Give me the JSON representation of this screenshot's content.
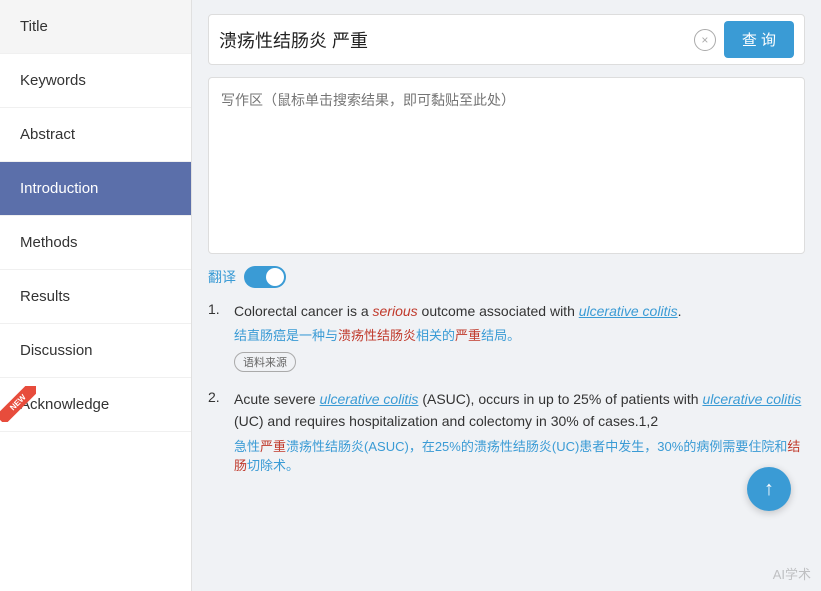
{
  "sidebar": {
    "items": [
      {
        "id": "title",
        "label": "Title",
        "active": false,
        "new": false
      },
      {
        "id": "keywords",
        "label": "Keywords",
        "active": false,
        "new": false
      },
      {
        "id": "abstract",
        "label": "Abstract",
        "active": false,
        "new": false
      },
      {
        "id": "introduction",
        "label": "Introduction",
        "active": true,
        "new": false
      },
      {
        "id": "methods",
        "label": "Methods",
        "active": false,
        "new": false
      },
      {
        "id": "results",
        "label": "Results",
        "active": false,
        "new": false
      },
      {
        "id": "discussion",
        "label": "Discussion",
        "active": false,
        "new": false
      },
      {
        "id": "acknowledge",
        "label": "Acknowledge",
        "active": false,
        "new": true
      }
    ]
  },
  "search": {
    "query": "溃疡性结肠炎 严重",
    "clear_title": "×",
    "submit_label": "查 询",
    "placeholder": "写作区（鼠标单击搜索结果，即可黏贴至此处）"
  },
  "translate": {
    "label": "翻译",
    "enabled": true
  },
  "results": [
    {
      "number": "1.",
      "en_parts": [
        {
          "text": "Colorectal cancer is a ",
          "style": "normal"
        },
        {
          "text": "serious",
          "style": "italic-red"
        },
        {
          "text": " outcome associated with ",
          "style": "normal"
        },
        {
          "text": "ulcerative colitis",
          "style": "italic-blue-link"
        },
        {
          "text": ".",
          "style": "normal"
        }
      ],
      "zh": "结直肠癌是一种与溃疡性结肠炎相关的严重结局。",
      "has_source": true,
      "source_label": "语料来源"
    },
    {
      "number": "2.",
      "en_parts": [
        {
          "text": "Acute severe ",
          "style": "normal"
        },
        {
          "text": "ulcerative colitis",
          "style": "italic-blue-link"
        },
        {
          "text": " (ASUC), occurs in up to 25% of patients with ",
          "style": "normal"
        },
        {
          "text": "ulcerative colitis",
          "style": "italic-blue-link"
        },
        {
          "text": " (UC) and requires hospitalization and colectomy in 30% of cases.1,2",
          "style": "normal"
        }
      ],
      "zh": "急性严重溃疡性结肠炎(ASUC)，在25%的溃疡性结肠炎(UC)患者中发生，30%的病例需要住院和结肠切除术。",
      "has_source": false,
      "source_label": ""
    }
  ],
  "scroll_top": "↑",
  "watermark": "AI学术"
}
